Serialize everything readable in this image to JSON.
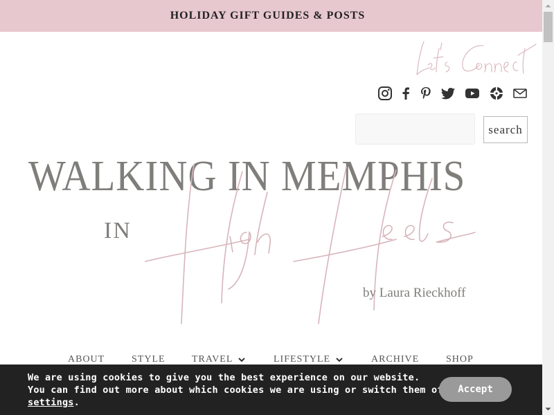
{
  "topbar": {
    "link_label": "HOLIDAY GIFT GUIDES & POSTS"
  },
  "connect": {
    "script_text": "Let's Connect"
  },
  "social": {
    "icons": [
      "instagram-icon",
      "facebook-icon",
      "pinterest-icon",
      "twitter-icon",
      "youtube-icon",
      "ltk-icon",
      "mail-icon"
    ]
  },
  "search": {
    "value": "",
    "placeholder": "",
    "button_label": "search"
  },
  "logo": {
    "line1": "WALKING IN MEMPHIS",
    "line2": "IN",
    "script": "High Heels",
    "byline": "by Laura Rieckhoff"
  },
  "nav": {
    "items": [
      {
        "label": "ABOUT",
        "has_dropdown": false
      },
      {
        "label": "STYLE",
        "has_dropdown": false
      },
      {
        "label": "TRAVEL",
        "has_dropdown": true
      },
      {
        "label": "LIFESTYLE",
        "has_dropdown": true
      },
      {
        "label": "ARCHIVE",
        "has_dropdown": false
      },
      {
        "label": "SHOP",
        "has_dropdown": false
      }
    ]
  },
  "cookie": {
    "line1": "We are using cookies to give you the best experience on our website.",
    "line2_prefix": "You can find out more about which cookies we are using or switch them off in",
    "settings_link": "settings",
    "line3_suffix": ".",
    "accept_label": "Accept"
  },
  "colors": {
    "topbar_bg": "#e8c8cf",
    "logo_gray": "#807e7b",
    "script_pink": "#d8b4bb",
    "cookie_bg": "#222222",
    "accept_bg": "#9a9a9a"
  }
}
